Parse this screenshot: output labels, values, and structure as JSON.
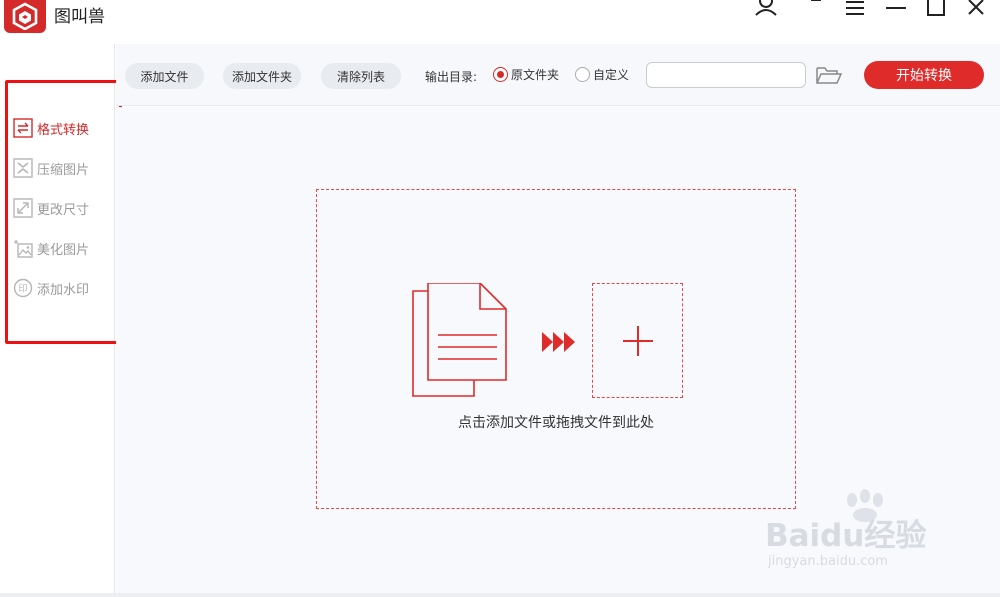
{
  "app": {
    "title": "图叫兽",
    "brand_color": "#d42a2a"
  },
  "window_controls": [
    "user-icon",
    "minimize-icon",
    "menu-icon",
    "minimize-icon",
    "maximize-icon",
    "close-icon"
  ],
  "sidebar": {
    "items": [
      {
        "label": "格式转换",
        "icon": "swap-arrows-icon",
        "active": true
      },
      {
        "label": "压缩图片",
        "icon": "compress-icon",
        "active": false
      },
      {
        "label": "更改尺寸",
        "icon": "resize-icon",
        "active": false
      },
      {
        "label": "美化图片",
        "icon": "beautify-image-icon",
        "active": false
      },
      {
        "label": "添加水印",
        "icon": "watermark-icon",
        "active": false
      }
    ],
    "highlight_color": "#ee1111"
  },
  "toolbar": {
    "add_file": "添加文件",
    "add_folder": "添加文件夹",
    "clear_list": "清除列表",
    "output_dir_label": "输出目录:",
    "radio_original": "原文件夹",
    "radio_custom": "自定义",
    "selected_output": "原文件夹",
    "path_value": "",
    "start_button": "开始转换"
  },
  "dropzone": {
    "hint": "点击添加文件或拖拽文件到此处"
  },
  "watermark": {
    "main": "Baidu经验",
    "sub": "jingyan.baidu.com"
  }
}
